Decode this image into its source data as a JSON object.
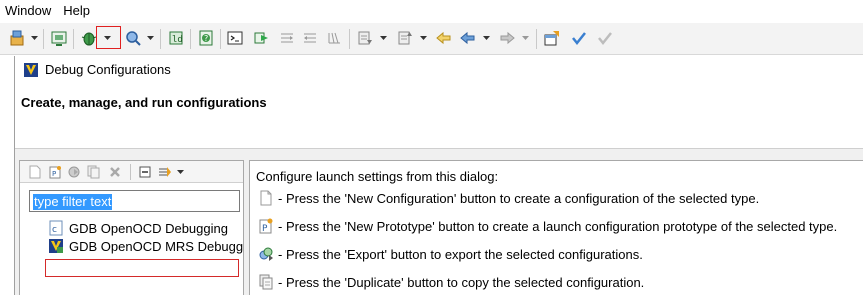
{
  "menubar": {
    "items": [
      "Window",
      "Help"
    ]
  },
  "toolbar": {
    "icons": [
      "save-all-icon",
      "terminal-icon",
      "debug-bug-icon",
      "search-icon",
      "build-icon",
      "help-icon",
      "console-icon",
      "step-into-icon",
      "step-over-icon",
      "step-return-icon",
      "drop-to-frame-icon",
      "next-annotation-icon",
      "previous-annotation-icon",
      "back-icon",
      "forward-icon",
      "open-perspective-icon",
      "checkmark-icon"
    ]
  },
  "dialog": {
    "title": "Debug Configurations",
    "banner_title": "Create, manage, and run configurations",
    "left_pane": {
      "filter_text": "type filter text",
      "toolbar_icons": [
        "new-configuration-icon",
        "new-prototype-icon",
        "export-icon",
        "duplicate-icon",
        "delete-icon",
        "collapse-all-icon",
        "filter-icon"
      ],
      "tree": [
        {
          "label": "GDB OpenOCD Debugging",
          "icon": "c-file-icon"
        },
        {
          "label": "GDB OpenOCD MRS Debugg",
          "icon": "mrs-debug-icon"
        }
      ]
    },
    "right_pane": {
      "header": "Configure launch settings from this dialog:",
      "lines": [
        {
          "icon": "new-configuration-icon",
          "text": "- Press the 'New Configuration' button to create a configuration of the selected type."
        },
        {
          "icon": "new-prototype-icon",
          "text": "- Press the 'New Prototype' button to create a launch configuration prototype of the selected type."
        },
        {
          "icon": "export-icon",
          "text": "- Press the 'Export' button to export the selected configurations."
        },
        {
          "icon": "duplicate-icon",
          "text": "- Press the 'Duplicate' button to copy the selected configuration."
        }
      ]
    }
  },
  "colors": {
    "selection": "#3399ff",
    "highlight_red": "#e02020",
    "dialog_bg": "#f0f0f0"
  }
}
